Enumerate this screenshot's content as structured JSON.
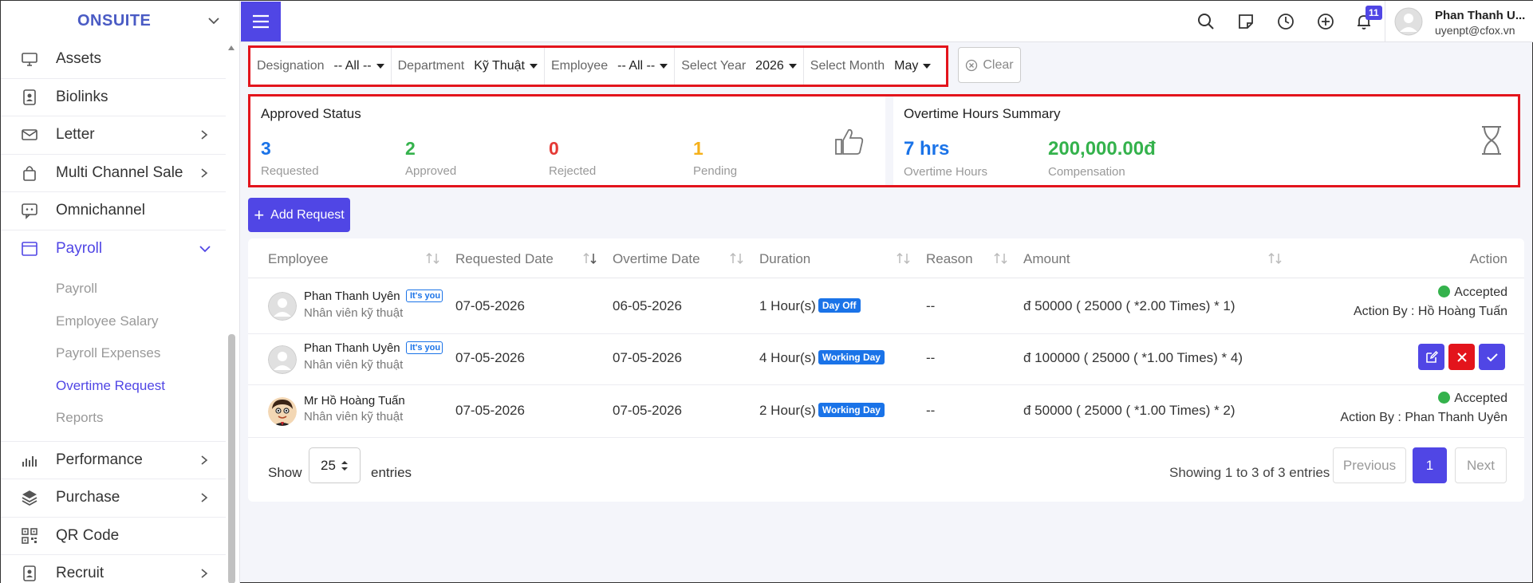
{
  "brand": {
    "name": "ONSUITE"
  },
  "sidebar": {
    "items": [
      {
        "label": "Assets",
        "icon": "monitor-icon",
        "has_chevron": false
      },
      {
        "label": "Biolinks",
        "icon": "id-badge-icon",
        "has_chevron": false
      },
      {
        "label": "Letter",
        "icon": "envelope-icon",
        "has_chevron": true
      },
      {
        "label": "Multi Channel Sale",
        "icon": "shopping-bag-icon",
        "has_chevron": true
      },
      {
        "label": "Omnichannel",
        "icon": "chat-icon",
        "has_chevron": false
      },
      {
        "label": "Payroll",
        "icon": "window-icon",
        "has_chevron": true,
        "expanded": true
      },
      {
        "label": "Performance",
        "icon": "bar-chart-icon",
        "has_chevron": true
      },
      {
        "label": "Purchase",
        "icon": "layers-icon",
        "has_chevron": true
      },
      {
        "label": "QR Code",
        "icon": "qr-code-icon",
        "has_chevron": false
      },
      {
        "label": "Recruit",
        "icon": "id-badge-icon",
        "has_chevron": true
      }
    ],
    "payroll_sub": [
      "Payroll",
      "Employee Salary",
      "Payroll Expenses",
      "Overtime Request",
      "Reports"
    ],
    "active_sub": "Overtime Request"
  },
  "header": {
    "notification_count": "11",
    "user_name": "Phan Thanh U...",
    "user_email": "uyenpt@cfox.vn"
  },
  "filters": {
    "designation": {
      "label": "Designation",
      "value": "-- All --"
    },
    "department": {
      "label": "Department",
      "value": "Kỹ Thuật"
    },
    "employee": {
      "label": "Employee",
      "value": "-- All --"
    },
    "year": {
      "label": "Select Year",
      "value": "2026"
    },
    "month": {
      "label": "Select Month",
      "value": "May"
    },
    "clear_label": "Clear"
  },
  "approved_status": {
    "title": "Approved Status",
    "requested": {
      "value": "3",
      "label": "Requested"
    },
    "approved": {
      "value": "2",
      "label": "Approved"
    },
    "rejected": {
      "value": "0",
      "label": "Rejected"
    },
    "pending": {
      "value": "1",
      "label": "Pending"
    }
  },
  "overtime_summary": {
    "title": "Overtime Hours Summary",
    "hours": {
      "value": "7 hrs",
      "label": "Overtime Hours"
    },
    "compensation": {
      "value": "200,000.00đ",
      "label": "Compensation"
    }
  },
  "add_request_label": "Add Request",
  "table": {
    "columns": [
      "Employee",
      "Requested Date",
      "Overtime Date",
      "Duration",
      "Reason",
      "Amount",
      "Action"
    ],
    "rows": [
      {
        "name": "Phan Thanh Uyên",
        "its_you": "It's you",
        "title": "Nhân viên kỹ thuật",
        "requested_date": "07-05-2026",
        "overtime_date": "06-05-2026",
        "duration": "1 Hour(s)",
        "day_type": "Day Off",
        "reason": "--",
        "amount": "đ 50000 ( 25000 ( *2.00 Times) * 1)",
        "status": "Accepted",
        "action_by": "Action By : Hồ Hoàng Tuấn"
      },
      {
        "name": "Phan Thanh Uyên",
        "its_you": "It's you",
        "title": "Nhân viên kỹ thuật",
        "requested_date": "07-05-2026",
        "overtime_date": "07-05-2026",
        "duration": "4 Hour(s)",
        "day_type": "Working Day",
        "reason": "--",
        "amount": "đ 100000 ( 25000 ( *1.00 Times) * 4)"
      },
      {
        "name": "Mr Hồ Hoàng Tuấn",
        "title": "Nhân viên kỹ thuật",
        "requested_date": "07-05-2026",
        "overtime_date": "07-05-2026",
        "duration": "2 Hour(s)",
        "day_type": "Working Day",
        "reason": "--",
        "amount": "đ 50000 ( 25000 ( *1.00 Times) * 2)",
        "status": "Accepted",
        "action_by": "Action By : Phan Thanh Uyên"
      }
    ]
  },
  "pagination": {
    "show_label": "Show",
    "page_length": "25",
    "entries_label": "entries",
    "info": "Showing 1 to 3 of 3 entries",
    "previous": "Previous",
    "current_page": "1",
    "next": "Next"
  },
  "colors": {
    "accent": "#5046e5",
    "highlight_border": "#e3141c",
    "blue": "#1a73e8",
    "green": "#34b24c",
    "red": "#e53935",
    "amber": "#f5b01a"
  }
}
